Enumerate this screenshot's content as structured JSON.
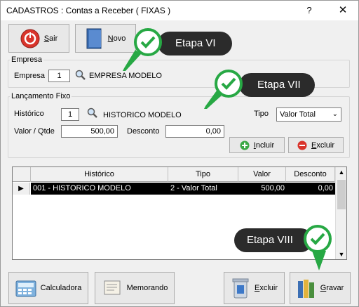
{
  "window": {
    "title": "CADASTROS : Contas a Receber ( FIXAS )",
    "help_glyph": "?",
    "close_glyph": "✕"
  },
  "toolbar": {
    "sair_prefix": "S",
    "sair_rest": "air",
    "novo_prefix": "N",
    "novo_rest": "ovo"
  },
  "empresa": {
    "group_label": "Empresa",
    "field_label": "Empresa",
    "code": "1",
    "name": "EMPRESA MODELO"
  },
  "lancamento": {
    "group_label": "Lançamento Fixo",
    "historico_label": "Histórico",
    "historico_code": "1",
    "historico_name": "HISTORICO MODELO",
    "tipo_label": "Tipo",
    "tipo_value": "Valor Total",
    "valor_label": "Valor / Qtde",
    "valor_value": "500,00",
    "desconto_label": "Desconto",
    "desconto_value": "0,00",
    "incluir_prefix": "I",
    "incluir_rest": "ncluir",
    "excluir_prefix": "E",
    "excluir_rest": "xcluir"
  },
  "grid": {
    "columns": [
      "Histórico",
      "Tipo",
      "Valor",
      "Desconto"
    ],
    "rows": [
      {
        "historico": "001 - HISTORICO MODELO",
        "tipo": "2 - Valor Total",
        "valor": "500,00",
        "desconto": "0,00"
      }
    ]
  },
  "bottom": {
    "calculadora": "Calculadora",
    "memorando": "Memorando",
    "excluir_prefix": "E",
    "excluir_rest": "xcluir",
    "gravar_prefix": "G",
    "gravar_rest": "ravar"
  },
  "callouts": {
    "etapa6": "Etapa VI",
    "etapa7": "Etapa VII",
    "etapa8": "Etapa VIII"
  },
  "colors": {
    "callout_bg": "#2b2b2b",
    "check_green": "#27a844",
    "selection": "#000000"
  }
}
